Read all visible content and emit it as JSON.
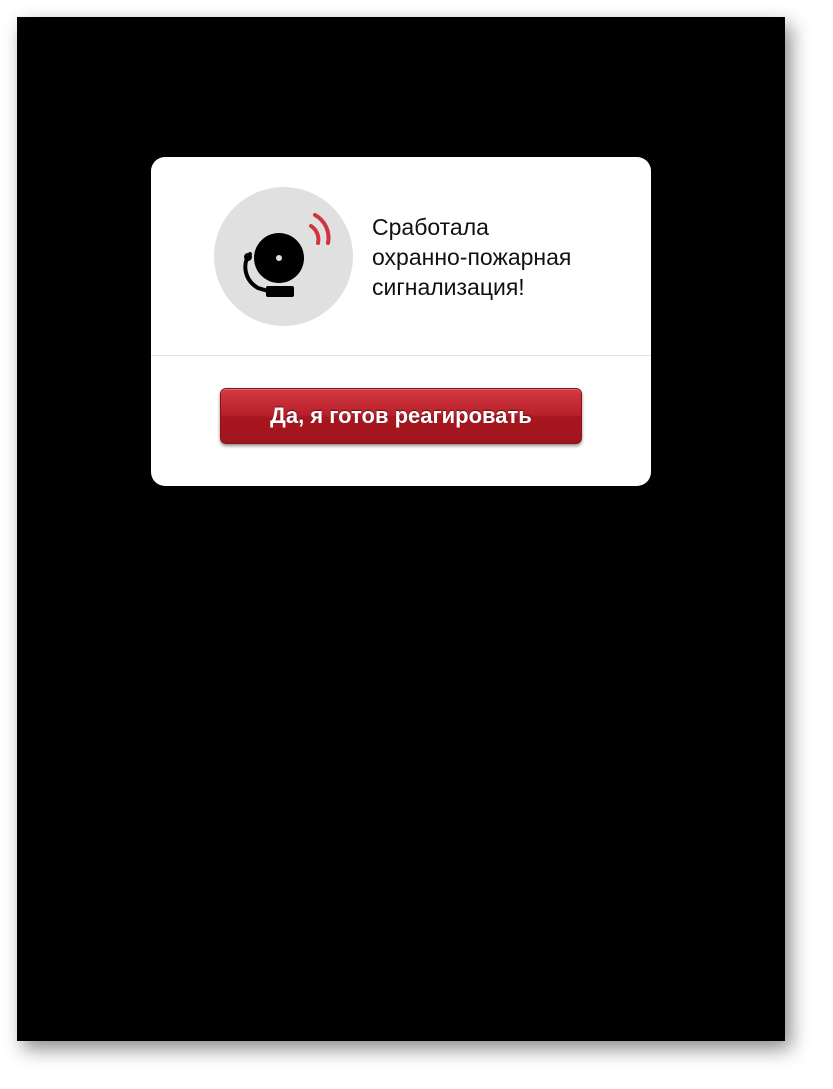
{
  "dialog": {
    "icon": "alarm-bell-icon",
    "message": "Сработала\nохранно-пожарная\nсигнализация!",
    "confirm_label": "Да, я готов реагировать"
  },
  "colors": {
    "background": "#000000",
    "dialog": "#ffffff",
    "icon_circle": "#e0e0e0",
    "icon_bell": "#000000",
    "icon_waves": "#d0343c",
    "button": "#b8202a",
    "button_text": "#ffffff"
  }
}
